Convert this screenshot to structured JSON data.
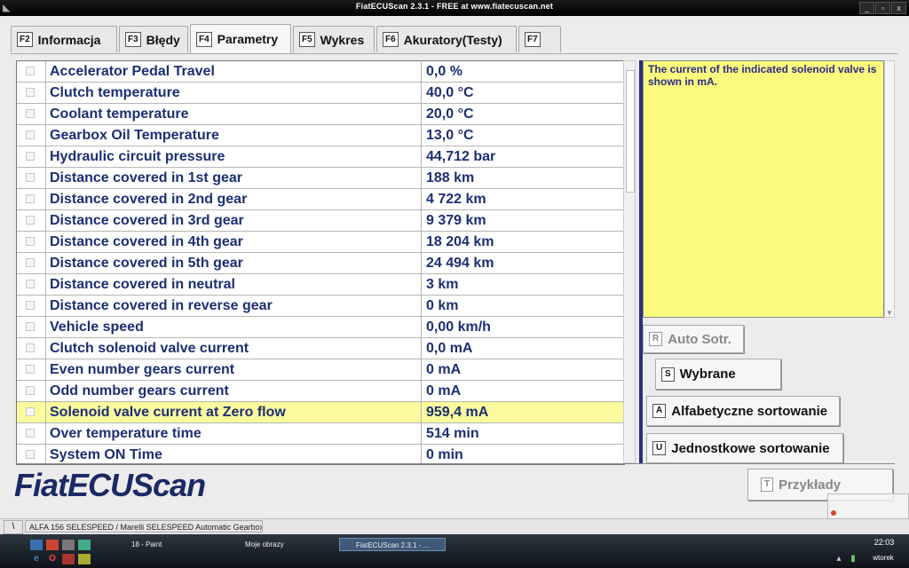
{
  "window": {
    "title": "FiatECUScan 2.3.1 - FREE at www.fiatecuscan.net",
    "btn_min": "_",
    "btn_max": "▫",
    "btn_close": "x"
  },
  "tabs": [
    {
      "key": "F2",
      "label": "Informacja"
    },
    {
      "key": "F3",
      "label": "Błędy"
    },
    {
      "key": "F4",
      "label": "Parametry",
      "active": true
    },
    {
      "key": "F5",
      "label": "Wykres"
    },
    {
      "key": "F6",
      "label": "Akuratory(Testy)"
    },
    {
      "key": "F7",
      "label": ""
    }
  ],
  "parameters": [
    {
      "name": "Accelerator Pedal Travel",
      "value": "0,0 %"
    },
    {
      "name": "Clutch temperature",
      "value": "40,0 °C"
    },
    {
      "name": "Coolant temperature",
      "value": "20,0 °C"
    },
    {
      "name": "Gearbox Oil Temperature",
      "value": "13,0 °C"
    },
    {
      "name": "Hydraulic circuit pressure",
      "value": "44,712 bar"
    },
    {
      "name": "Distance covered in 1st gear",
      "value": "188 km"
    },
    {
      "name": "Distance covered in 2nd gear",
      "value": "4 722 km"
    },
    {
      "name": "Distance covered in 3rd gear",
      "value": "9 379 km"
    },
    {
      "name": "Distance covered in 4th gear",
      "value": "18 204 km"
    },
    {
      "name": "Distance covered in 5th gear",
      "value": "24 494 km"
    },
    {
      "name": "Distance covered in neutral",
      "value": "3 km"
    },
    {
      "name": "Distance covered in reverse gear",
      "value": "0 km"
    },
    {
      "name": "Vehicle speed",
      "value": "0,00 km/h"
    },
    {
      "name": "Clutch solenoid valve current",
      "value": "0,0 mA"
    },
    {
      "name": "Even number gears current",
      "value": "0 mA"
    },
    {
      "name": "Odd number gears current",
      "value": "0 mA"
    },
    {
      "name": "Solenoid valve current at Zero flow",
      "value": "959,4 mA",
      "highlighted": true
    },
    {
      "name": "Over temperature time",
      "value": "514 min"
    },
    {
      "name": "System ON Time",
      "value": "0 min"
    }
  ],
  "description": "The current of the indicated solenoid valve is shown in mA.",
  "buttons": {
    "auto_sort": {
      "key": "R",
      "label": "Auto Sotr."
    },
    "selected": {
      "key": "S",
      "label": "Wybrane"
    },
    "alpha_sort": {
      "key": "A",
      "label": "Alfabetyczne sortowanie"
    },
    "unit_sort": {
      "key": "U",
      "label": "Jednostkowe sortowanie"
    },
    "examples": {
      "key": "T",
      "label": "Przykłady"
    }
  },
  "brand": "FiatECUScan",
  "statusbar": {
    "cell1": "\\",
    "vehicle": "ALFA 156 SELESPEED / Marelli SELESPEED Automatic Gearbox"
  },
  "taskbar": {
    "tasks": [
      "18 - Paint",
      "Moje obrazy",
      "FiatECUScan 2.3.1 - ..."
    ],
    "time": "22:03",
    "day": "wtorek"
  },
  "colors": {
    "accent": "#1c2f73",
    "highlight": "#fbfb9e",
    "description_bg": "#fafa7c"
  }
}
